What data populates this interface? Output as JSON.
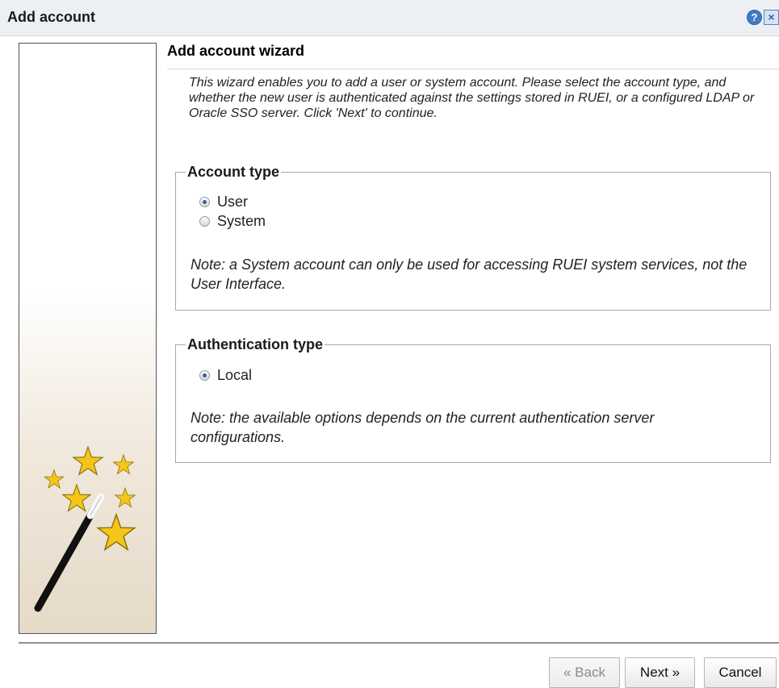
{
  "dialog": {
    "title": "Add account",
    "help_glyph": "?",
    "close_glyph": "×",
    "icons": [
      "help-icon",
      "close-icon",
      "magic-wand-icon",
      "radio-icon"
    ]
  },
  "wizard": {
    "header": "Add account wizard",
    "intro": "This wizard enables you to add a user or system account. Please select the account type, and whether the new user is authenticated against the settings stored in RUEI, or a configured LDAP or Oracle SSO server. Click 'Next' to continue."
  },
  "account_type": {
    "legend": "Account type",
    "options": [
      {
        "label": "User",
        "checked": true
      },
      {
        "label": "System",
        "checked": false
      }
    ],
    "note": "Note: a System account can only be used for accessing RUEI system services, not the User Interface."
  },
  "auth_type": {
    "legend": "Authentication type",
    "options": [
      {
        "label": "Local",
        "checked": true
      }
    ],
    "note": "Note: the available options depends on the current authentication server configurations."
  },
  "buttons": {
    "back": "« Back",
    "next": "Next »",
    "cancel": "Cancel"
  },
  "colors": {
    "title_bar": "#ecf0f5",
    "star": "#f5c61a",
    "help_icon": "#3f7cc4"
  }
}
